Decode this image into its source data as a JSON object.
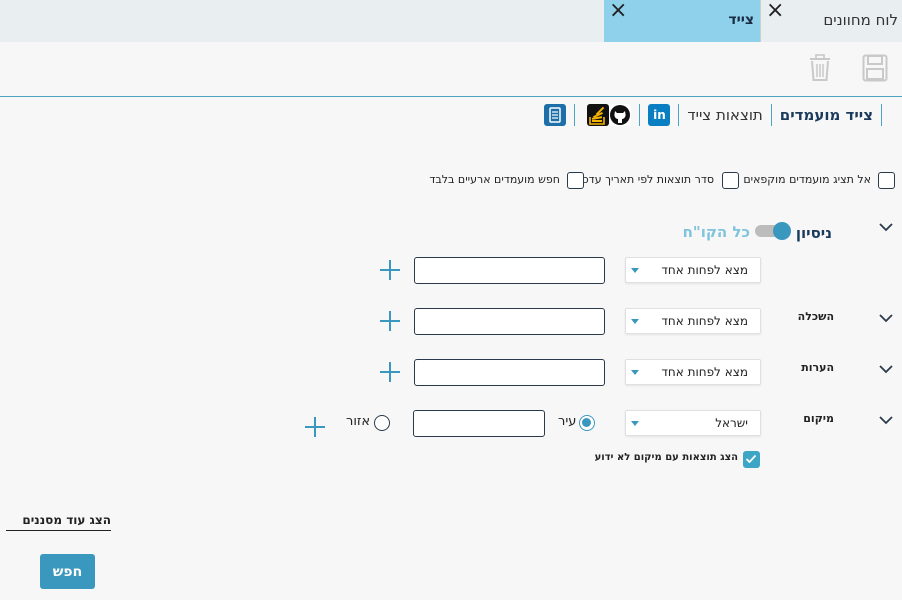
{
  "tabs": [
    {
      "label": "לוח מחוונים",
      "close": "×"
    },
    {
      "label": "צייד",
      "close": "×"
    }
  ],
  "toolbar": {
    "save_icon": "save-icon",
    "delete_icon": "trash-icon"
  },
  "navtabs": {
    "candidates": "צייד מועמדים",
    "results": "תוצאות צייד",
    "icons": [
      "linkedin-icon",
      "github-icon",
      "stackoverflow-icon",
      "document-icon"
    ]
  },
  "options": {
    "hide_flagged": "אל תציג מועמדים מוקפאים",
    "sort_by_update": "סדר תוצאות לפי תאריך עדכון",
    "temp_only": "חפש מועמדים ארעיים בלבד"
  },
  "experience": {
    "label": "ניסיון",
    "toggle_label": "כל הקו\"ח",
    "select_value": "מצא לפחות אחד"
  },
  "education": {
    "label": "השכלה",
    "select_value": "מצא לפחות אחד"
  },
  "notes": {
    "label": "הערות",
    "select_value": "מצא לפחות אחד"
  },
  "location": {
    "label": "מיקום",
    "select_value": "ישראל",
    "city_label": "עיר",
    "region_label": "אזור",
    "show_unknown": "הצג תוצאות עם מיקום לא ידוע"
  },
  "footer": {
    "more_filters": "הצג עוד מסננים",
    "search": "חפש"
  },
  "colors": {
    "accent": "#3a98be",
    "tab_active": "#8fd1ea",
    "tab_bar": "#e9eef0"
  }
}
